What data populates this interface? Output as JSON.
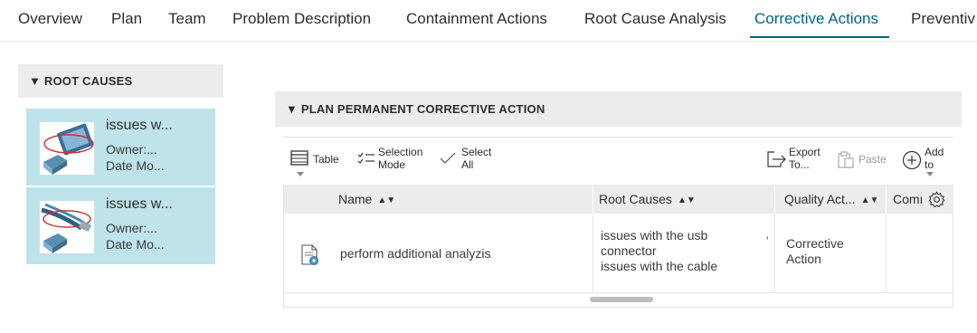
{
  "tabs": [
    {
      "label": "Overview",
      "active": false
    },
    {
      "label": "Plan",
      "active": false
    },
    {
      "label": "Team",
      "active": false
    },
    {
      "label": "Problem Description",
      "active": false
    },
    {
      "label": "Containment Actions",
      "active": false
    },
    {
      "label": "Root Cause Analysis",
      "active": false
    },
    {
      "label": "Corrective Actions",
      "active": true
    },
    {
      "label": "Preventiv",
      "active": false
    }
  ],
  "root_causes": {
    "header": "▼ ROOT CAUSES",
    "items": [
      {
        "title": "issues w...",
        "owner": "Owner:...",
        "date": "Date Mo...",
        "thumb_icon": "usb-connector-thumbnail"
      },
      {
        "title": "issues w...",
        "owner": "Owner:...",
        "date": "Date Mo...",
        "thumb_icon": "usb-cable-thumbnail"
      }
    ]
  },
  "plan": {
    "header": "▼ PLAN PERMANENT CORRECTIVE ACTION",
    "toolbar": {
      "table_label": "Table",
      "selection_mode_line1": "Selection",
      "selection_mode_line2": "Mode",
      "select_all_line1": "Select",
      "select_all_line2": "All",
      "export_line1": "Export",
      "export_line2": "To...",
      "paste_label": "Paste",
      "add_line1": "Add",
      "add_line2": "to"
    },
    "columns": [
      "Name",
      "Root Causes",
      "Quality Act...",
      "Comı"
    ],
    "rows": [
      {
        "icon": "document-badge-icon",
        "name": "perform additional analyzis",
        "root_causes": [
          "issues with the usb",
          "connector",
          "issues with the cable"
        ],
        "quality_action": [
          "Corrective",
          "Action"
        ]
      }
    ]
  },
  "colors": {
    "accent": "#006487",
    "card_bg": "#bfe3ea",
    "header_bg": "#ececec"
  }
}
